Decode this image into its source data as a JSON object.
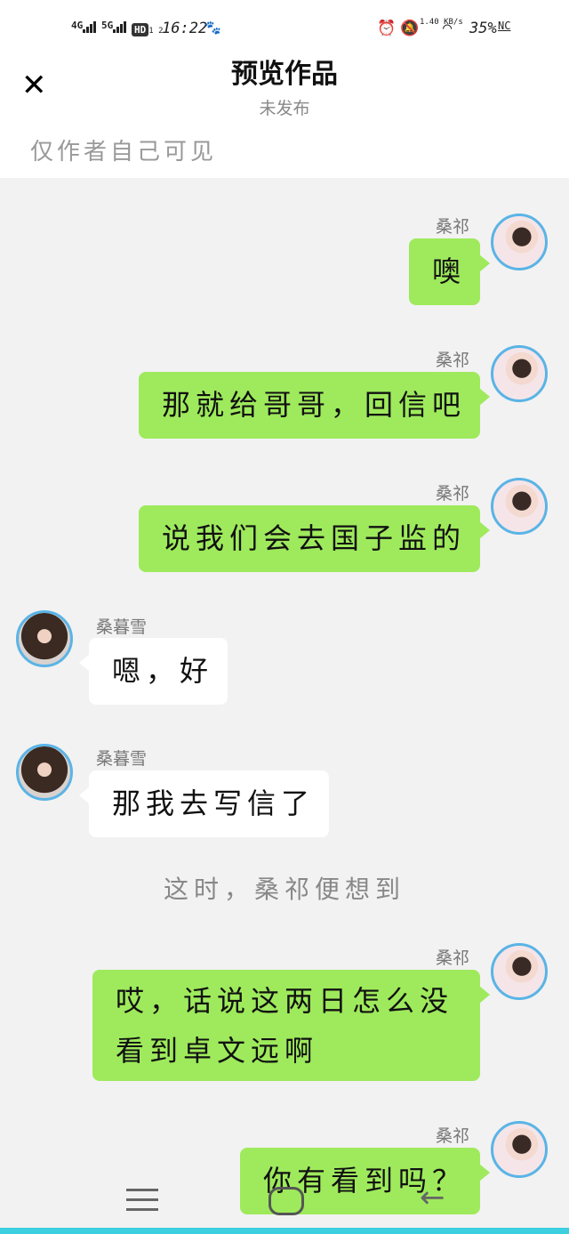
{
  "status_bar": {
    "network1": "4G",
    "network2": "5G",
    "hd": "HD",
    "hd_sub": "1 2",
    "time": "16:22",
    "speed": "1.40 KB/s",
    "battery": "35%",
    "nfc": "NC"
  },
  "header": {
    "title": "预览作品",
    "status": "未发布",
    "visibility": "仅作者自己可见"
  },
  "messages": [
    {
      "side": "right",
      "name": "桑祁",
      "text": "噢"
    },
    {
      "side": "right",
      "name": "桑祁",
      "text": "那就给哥哥，回信吧"
    },
    {
      "side": "right",
      "name": "桑祁",
      "text": "说我们会去国子监的"
    },
    {
      "side": "left",
      "name": "桑暮雪",
      "text": "嗯，好"
    },
    {
      "side": "left",
      "name": "桑暮雪",
      "text": "那我去写信了"
    },
    {
      "side": "narration",
      "text": "这时，桑祁便想到"
    },
    {
      "side": "right",
      "name": "桑祁",
      "text_line1": "哎，话说这两日怎么没",
      "text_line2": "看到卓文远啊"
    },
    {
      "side": "right",
      "name": "桑祁",
      "text": "你有看到吗？"
    }
  ],
  "colors": {
    "right_bubble": "#9eea5c",
    "left_bubble": "#ffffff",
    "avatar_border": "#5ab4e6",
    "background": "#f2f2f2"
  },
  "icons": [
    "close-icon",
    "menu-icon",
    "home-icon",
    "back-icon",
    "alarm-icon",
    "mute-icon",
    "wifi-icon",
    "signal-icon"
  ]
}
